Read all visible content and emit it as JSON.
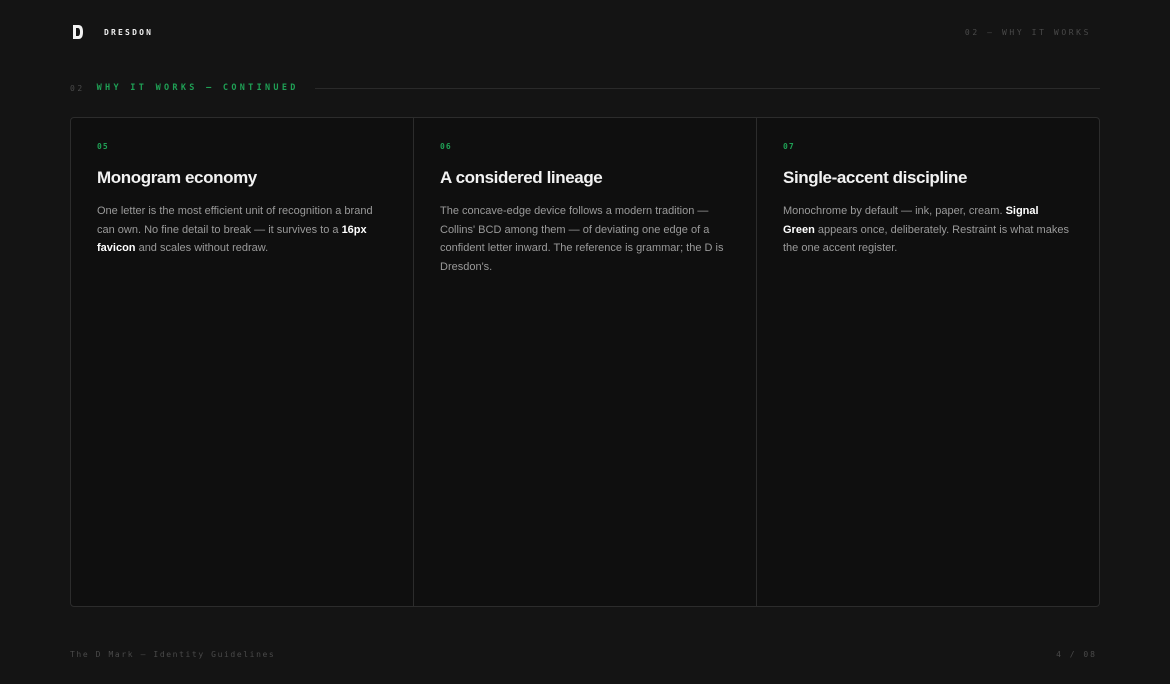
{
  "header": {
    "logo_icon": "d-monogram-icon",
    "brand_name": "DRESDON",
    "section_ref": "02 — WHY IT WORKS"
  },
  "section": {
    "number": "02",
    "title": "WHY IT WORKS — CONTINUED"
  },
  "cards": [
    {
      "number": "05",
      "title": "Monogram economy",
      "body": [
        {
          "text": "One letter is the most efficient unit of recognition a brand can own. No fine detail to break — it survives to a ",
          "strong": false
        },
        {
          "text": "16px favicon",
          "strong": true
        },
        {
          "text": " and scales without redraw.",
          "strong": false
        }
      ]
    },
    {
      "number": "06",
      "title": "A considered lineage",
      "body": [
        {
          "text": "The concave-edge device follows a modern tradition — Collins' BCD among them — of deviating one edge of a confident letter inward. The reference is grammar; the D is Dresdon's.",
          "strong": false
        }
      ]
    },
    {
      "number": "07",
      "title": "Single-accent discipline",
      "body": [
        {
          "text": "Monochrome by default — ink, paper, cream. ",
          "strong": false
        },
        {
          "text": "Signal Green",
          "strong": true
        },
        {
          "text": " appears once, deliberately. Restraint is what makes the one accent register.",
          "strong": false
        }
      ]
    }
  ],
  "footer": {
    "title": "The D Mark — Identity Guidelines",
    "page": "4 / 08"
  },
  "colors": {
    "background": "#141414",
    "accent": "#1fa055",
    "card_border": "#2c2c2c"
  }
}
